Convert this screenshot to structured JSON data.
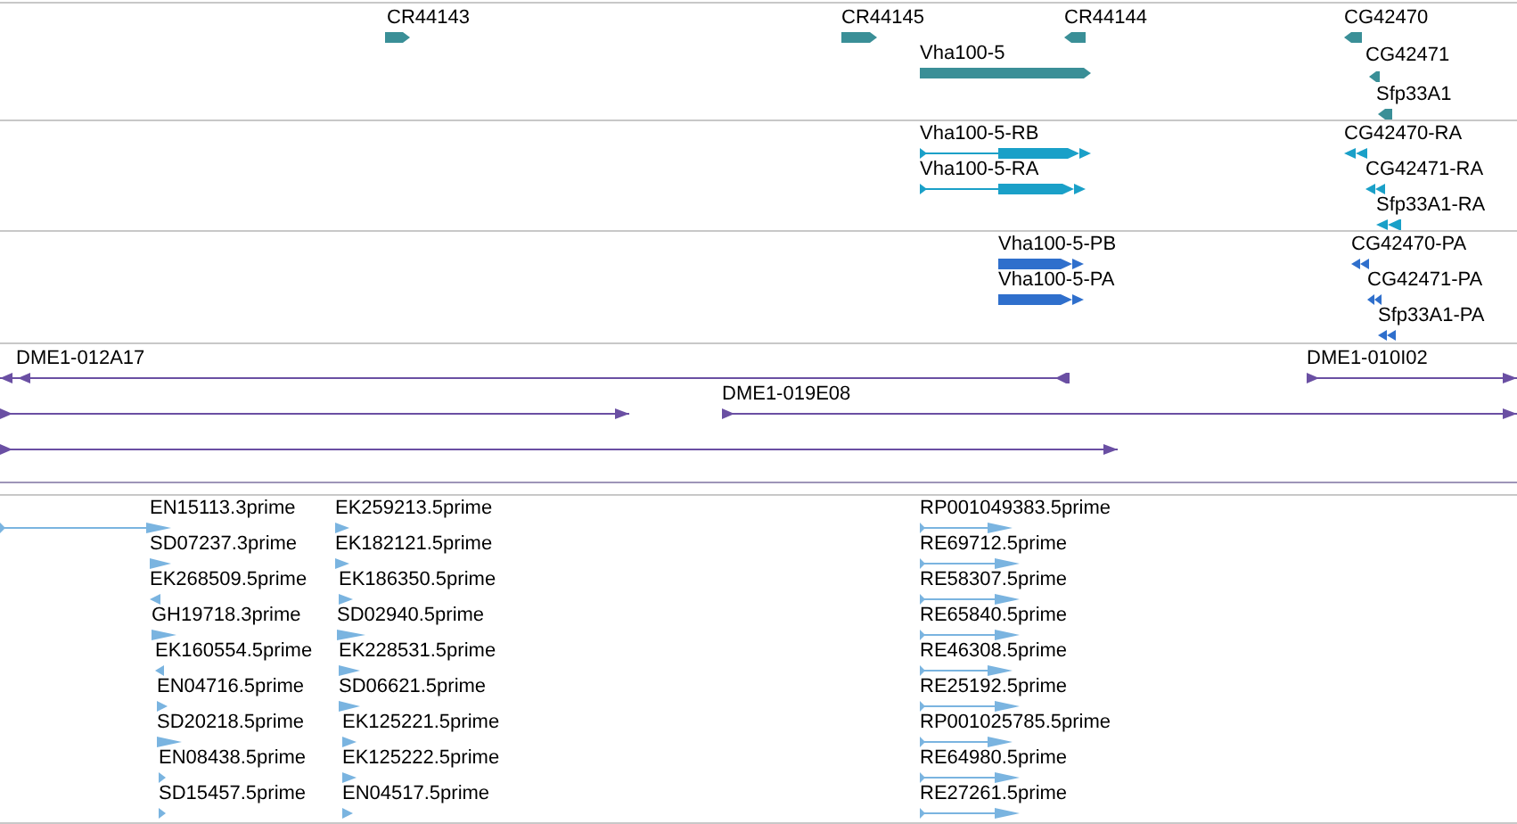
{
  "tracks": [
    {
      "kind": "gene",
      "color": "#3a8f97",
      "features": [
        {
          "label": "CR44143",
          "reverse": false
        },
        {
          "label": "CR44145",
          "reverse": false
        },
        {
          "label": "CR44144",
          "reverse": true
        },
        {
          "label": "CG42470",
          "reverse": true
        },
        {
          "label": "Vha100-5",
          "reverse": false
        },
        {
          "label": "CG42471",
          "reverse": true
        },
        {
          "label": "Sfp33A1",
          "reverse": true
        }
      ]
    },
    {
      "kind": "transcript",
      "color": "#1aa0c8",
      "features": [
        {
          "label": "Vha100-5-RB",
          "reverse": false
        },
        {
          "label": "CG42470-RA",
          "reverse": true
        },
        {
          "label": "Vha100-5-RA",
          "reverse": false
        },
        {
          "label": "CG42471-RA",
          "reverse": true
        },
        {
          "label": "Sfp33A1-RA",
          "reverse": true
        }
      ]
    },
    {
      "kind": "transcript",
      "color": "#2f6fcc",
      "features": [
        {
          "label": "Vha100-5-PB",
          "reverse": false
        },
        {
          "label": "CG42470-PA",
          "reverse": true
        },
        {
          "label": "Vha100-5-PA",
          "reverse": false
        },
        {
          "label": "CG42471-PA",
          "reverse": true
        },
        {
          "label": "Sfp33A1-PA",
          "reverse": true
        }
      ]
    },
    {
      "kind": "clone",
      "color": "#6a4fa3",
      "features": [
        {
          "label": "DME1-012A17",
          "reverse": true
        },
        {
          "label": "DME1-010I02",
          "reverse": false
        },
        {
          "reverse": false
        },
        {
          "label": "DME1-019E08",
          "reverse": false
        },
        {
          "reverse": false
        }
      ]
    },
    {
      "kind": "est",
      "color": "#7ab4e0",
      "features": [
        {
          "label": "EN15113.3prime",
          "reverse": false
        },
        {
          "label": "EK259213.5prime",
          "reverse": false
        },
        {
          "label": "RP001049383.5prime",
          "reverse": false
        },
        {
          "label": "SD07237.3prime",
          "reverse": false
        },
        {
          "label": "EK182121.5prime",
          "reverse": false
        },
        {
          "label": "RE69712.5prime",
          "reverse": false
        },
        {
          "label": "EK268509.5prime",
          "reverse": true
        },
        {
          "label": "EK186350.5prime",
          "reverse": false
        },
        {
          "label": "RE58307.5prime",
          "reverse": false
        },
        {
          "label": "GH19718.3prime",
          "reverse": false
        },
        {
          "label": "SD02940.5prime",
          "reverse": false
        },
        {
          "label": "RE65840.5prime",
          "reverse": false
        },
        {
          "label": "EK160554.5prime",
          "reverse": true
        },
        {
          "label": "EK228531.5prime",
          "reverse": false
        },
        {
          "label": "RE46308.5prime",
          "reverse": false
        },
        {
          "label": "EN04716.5prime",
          "reverse": false
        },
        {
          "label": "SD06621.5prime",
          "reverse": false
        },
        {
          "label": "RE25192.5prime",
          "reverse": false
        },
        {
          "label": "SD20218.5prime",
          "reverse": false
        },
        {
          "label": "EK125221.5prime",
          "reverse": false
        },
        {
          "label": "RP001025785.5prime",
          "reverse": false
        },
        {
          "label": "EN08438.5prime",
          "reverse": false
        },
        {
          "label": "EK125222.5prime",
          "reverse": false
        },
        {
          "label": "RE64980.5prime",
          "reverse": false
        },
        {
          "label": "SD15457.5prime",
          "reverse": false
        },
        {
          "label": "EN04517.5prime",
          "reverse": false
        },
        {
          "label": "RE27261.5prime",
          "reverse": false
        }
      ]
    }
  ]
}
